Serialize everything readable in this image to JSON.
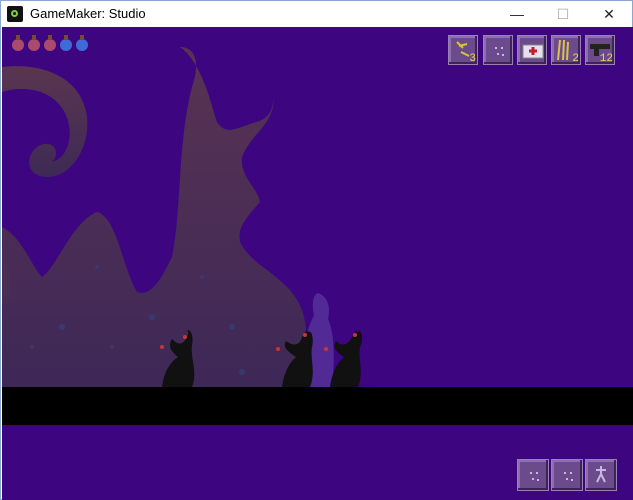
{
  "window": {
    "title": "GameMaker: Studio",
    "controls": {
      "minimize": "—",
      "maximize": "☐",
      "close": "✕"
    }
  },
  "hud": {
    "life_orbs": [
      {
        "color": "#a94a6e"
      },
      {
        "color": "#a94a6e"
      },
      {
        "color": "#a94a6e"
      },
      {
        "color": "#3f6bd6"
      },
      {
        "color": "#3f6bd6"
      }
    ],
    "inventory": [
      {
        "icon": "key-bundle-icon",
        "count": "3"
      },
      {
        "icon": "empty-slot-icon",
        "count": ""
      },
      {
        "icon": "medkit-icon",
        "count": ""
      },
      {
        "icon": "torch-bundle-icon",
        "count": "2"
      },
      {
        "icon": "gun-icon",
        "count": "12"
      }
    ]
  },
  "controls_bottom": [
    {
      "icon": "empty-slot-icon"
    },
    {
      "icon": "empty-slot-icon"
    },
    {
      "icon": "figure-icon"
    }
  ],
  "colors": {
    "sky": "#3d0580",
    "ground": "#000000",
    "rock": "#4e2a4a"
  }
}
